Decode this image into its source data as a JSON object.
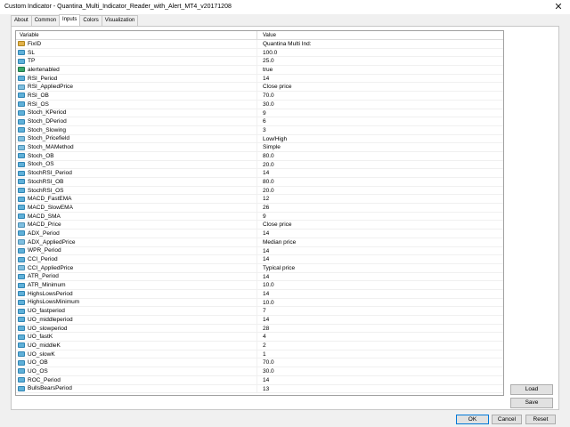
{
  "window": {
    "title": "Custom Indicator - Quantina_Multi_Indicator_Reader_with_Alert_MT4_v20171208",
    "close_glyph": "✕"
  },
  "tabs": [
    {
      "label": "About",
      "active": false
    },
    {
      "label": "Common",
      "active": false
    },
    {
      "label": "Inputs",
      "active": true
    },
    {
      "label": "Colors",
      "active": false
    },
    {
      "label": "Visualization",
      "active": false
    }
  ],
  "grid": {
    "header": {
      "variable": "Variable",
      "value": "Value"
    },
    "rows": [
      {
        "name": "FixID",
        "value": "Quantina Multi Ind:",
        "type": "str"
      },
      {
        "name": "SL",
        "value": "100.0",
        "type": "num"
      },
      {
        "name": "TP",
        "value": "25.0",
        "type": "num"
      },
      {
        "name": "alertenabled",
        "value": "true",
        "type": "bool"
      },
      {
        "name": "RSI_Period",
        "value": "14",
        "type": "num"
      },
      {
        "name": "RSI_AppliedPrice",
        "value": "Close price",
        "type": "enum"
      },
      {
        "name": "RSI_OB",
        "value": "70.0",
        "type": "num"
      },
      {
        "name": "RSI_OS",
        "value": "30.0",
        "type": "num"
      },
      {
        "name": "Stoch_KPeriod",
        "value": "9",
        "type": "num"
      },
      {
        "name": "Stoch_DPeriod",
        "value": "6",
        "type": "num"
      },
      {
        "name": "Stoch_Slowing",
        "value": "3",
        "type": "num"
      },
      {
        "name": "Stoch_Pricefield",
        "value": "Low/High",
        "type": "enum"
      },
      {
        "name": "Stoch_MAMethod",
        "value": "Simple",
        "type": "enum"
      },
      {
        "name": "Stoch_OB",
        "value": "80.0",
        "type": "num"
      },
      {
        "name": "Stoch_OS",
        "value": "20.0",
        "type": "num"
      },
      {
        "name": "StochRSI_Period",
        "value": "14",
        "type": "num"
      },
      {
        "name": "StochRSI_OB",
        "value": "80.0",
        "type": "num"
      },
      {
        "name": "StochRSI_OS",
        "value": "20.0",
        "type": "num"
      },
      {
        "name": "MACD_FastEMA",
        "value": "12",
        "type": "num"
      },
      {
        "name": "MACD_SlowEMA",
        "value": "26",
        "type": "num"
      },
      {
        "name": "MACD_SMA",
        "value": "9",
        "type": "num"
      },
      {
        "name": "MACD_Price",
        "value": "Close price",
        "type": "enum"
      },
      {
        "name": "ADX_Period",
        "value": "14",
        "type": "num"
      },
      {
        "name": "ADX_AppliedPrice",
        "value": "Median price",
        "type": "enum"
      },
      {
        "name": "WPR_Period",
        "value": "14",
        "type": "num"
      },
      {
        "name": "CCI_Period",
        "value": "14",
        "type": "num"
      },
      {
        "name": "CCI_AppliedPrice",
        "value": "Typical price",
        "type": "enum"
      },
      {
        "name": "ATR_Period",
        "value": "14",
        "type": "num"
      },
      {
        "name": "ATR_Minimum",
        "value": "10.0",
        "type": "num"
      },
      {
        "name": "HighsLowsPeriod",
        "value": "14",
        "type": "num"
      },
      {
        "name": "HighsLowsMinimum",
        "value": "10.0",
        "type": "num"
      },
      {
        "name": "UO_fastperiod",
        "value": "7",
        "type": "num"
      },
      {
        "name": "UO_middleperiod",
        "value": "14",
        "type": "num"
      },
      {
        "name": "UO_slowperiod",
        "value": "28",
        "type": "num"
      },
      {
        "name": "UO_fastK",
        "value": "4",
        "type": "num"
      },
      {
        "name": "UO_middleK",
        "value": "2",
        "type": "num"
      },
      {
        "name": "UO_slowK",
        "value": "1",
        "type": "num"
      },
      {
        "name": "UO_OB",
        "value": "70.0",
        "type": "num"
      },
      {
        "name": "UO_OS",
        "value": "30.0",
        "type": "num"
      },
      {
        "name": "ROC_Period",
        "value": "14",
        "type": "num"
      },
      {
        "name": "BullsBearsPeriod",
        "value": "13",
        "type": "num"
      }
    ]
  },
  "buttons": {
    "load": "Load",
    "save": "Save",
    "ok": "OK",
    "cancel": "Cancel",
    "reset": "Reset"
  }
}
